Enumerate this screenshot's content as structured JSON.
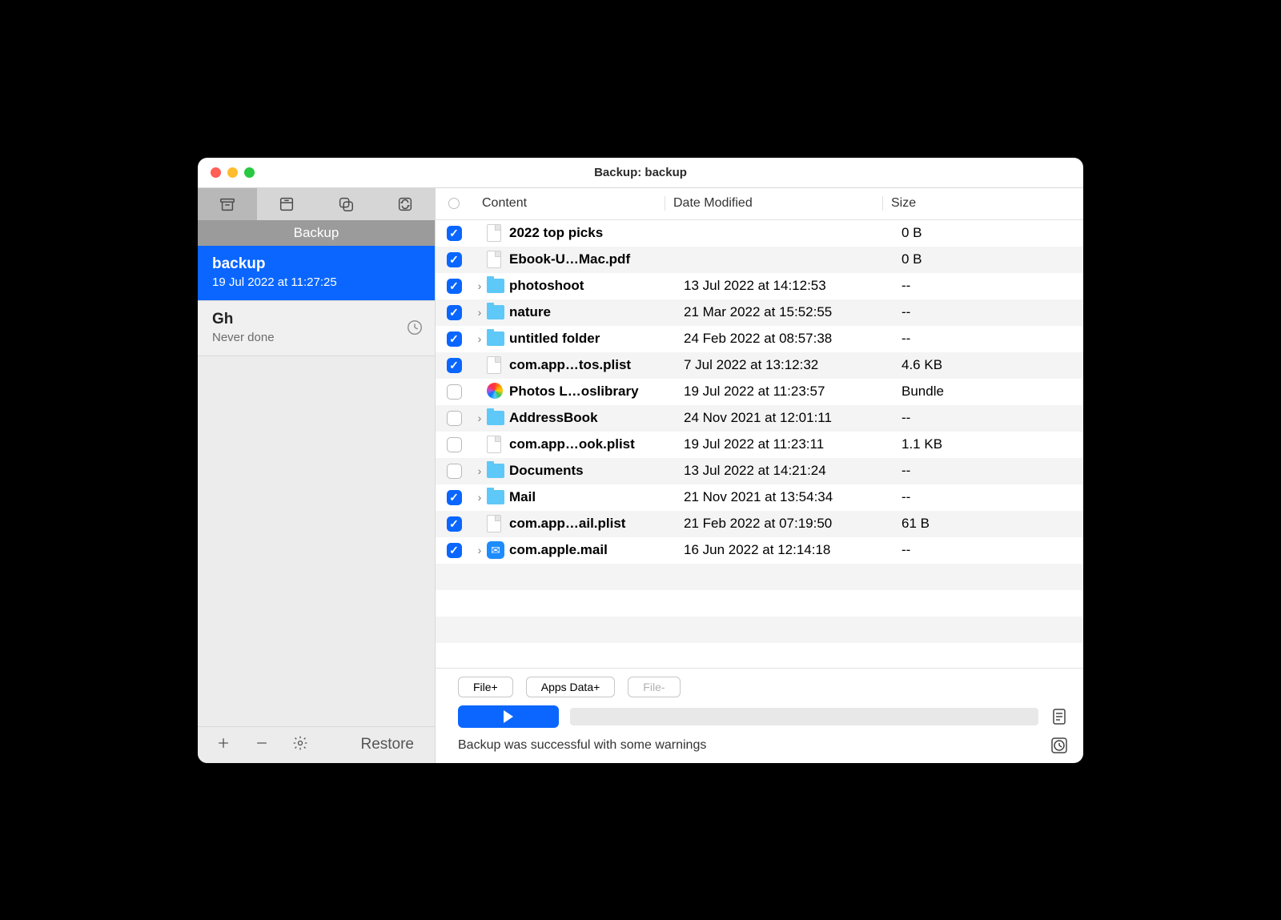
{
  "window": {
    "title": "Backup: backup"
  },
  "sidebar": {
    "header": "Backup",
    "items": [
      {
        "name": "backup",
        "subtitle": "19 Jul 2022 at 11:27:25",
        "selected": true,
        "clock": false
      },
      {
        "name": "Gh",
        "subtitle": "Never done",
        "selected": false,
        "clock": true
      }
    ],
    "restore_label": "Restore"
  },
  "columns": {
    "content": "Content",
    "date": "Date Modified",
    "size": "Size"
  },
  "rows": [
    {
      "checked": true,
      "expandable": false,
      "icon": "file",
      "name": "2022 top picks",
      "date": "",
      "size": "0 B"
    },
    {
      "checked": true,
      "expandable": false,
      "icon": "file",
      "name": "Ebook-U…Mac.pdf",
      "date": "",
      "size": "0 B"
    },
    {
      "checked": true,
      "expandable": true,
      "icon": "folder",
      "name": "photoshoot",
      "date": "13 Jul 2022 at 14:12:53",
      "size": "--"
    },
    {
      "checked": true,
      "expandable": true,
      "icon": "folder",
      "name": "nature",
      "date": "21 Mar 2022 at 15:52:55",
      "size": "--"
    },
    {
      "checked": true,
      "expandable": true,
      "icon": "folder",
      "name": "untitled folder",
      "date": "24 Feb 2022 at 08:57:38",
      "size": "--"
    },
    {
      "checked": true,
      "expandable": false,
      "icon": "file",
      "name": "com.app…tos.plist",
      "date": "7 Jul 2022 at 13:12:32",
      "size": "4.6 KB"
    },
    {
      "checked": false,
      "expandable": false,
      "icon": "photos",
      "name": "Photos L…oslibrary",
      "date": "19 Jul 2022 at 11:23:57",
      "size": "Bundle"
    },
    {
      "checked": false,
      "expandable": true,
      "icon": "folder",
      "name": "AddressBook",
      "date": "24 Nov 2021 at 12:01:11",
      "size": "--"
    },
    {
      "checked": false,
      "expandable": false,
      "icon": "file",
      "name": "com.app…ook.plist",
      "date": "19 Jul 2022 at 11:23:11",
      "size": "1.1 KB"
    },
    {
      "checked": false,
      "expandable": true,
      "icon": "folder",
      "name": "Documents",
      "date": "13 Jul 2022 at 14:21:24",
      "size": "--"
    },
    {
      "checked": true,
      "expandable": true,
      "icon": "folder",
      "name": "Mail",
      "date": "21 Nov 2021 at 13:54:34",
      "size": "--"
    },
    {
      "checked": true,
      "expandable": false,
      "icon": "file",
      "name": "com.app…ail.plist",
      "date": "21 Feb 2022 at 07:19:50",
      "size": "61 B"
    },
    {
      "checked": true,
      "expandable": true,
      "icon": "mail",
      "name": "com.apple.mail",
      "date": "16 Jun 2022 at 12:14:18",
      "size": "--"
    }
  ],
  "buttons": {
    "file_plus": "File+",
    "apps_data_plus": "Apps Data+",
    "file_minus": "File-"
  },
  "status": "Backup was successful with some warnings"
}
